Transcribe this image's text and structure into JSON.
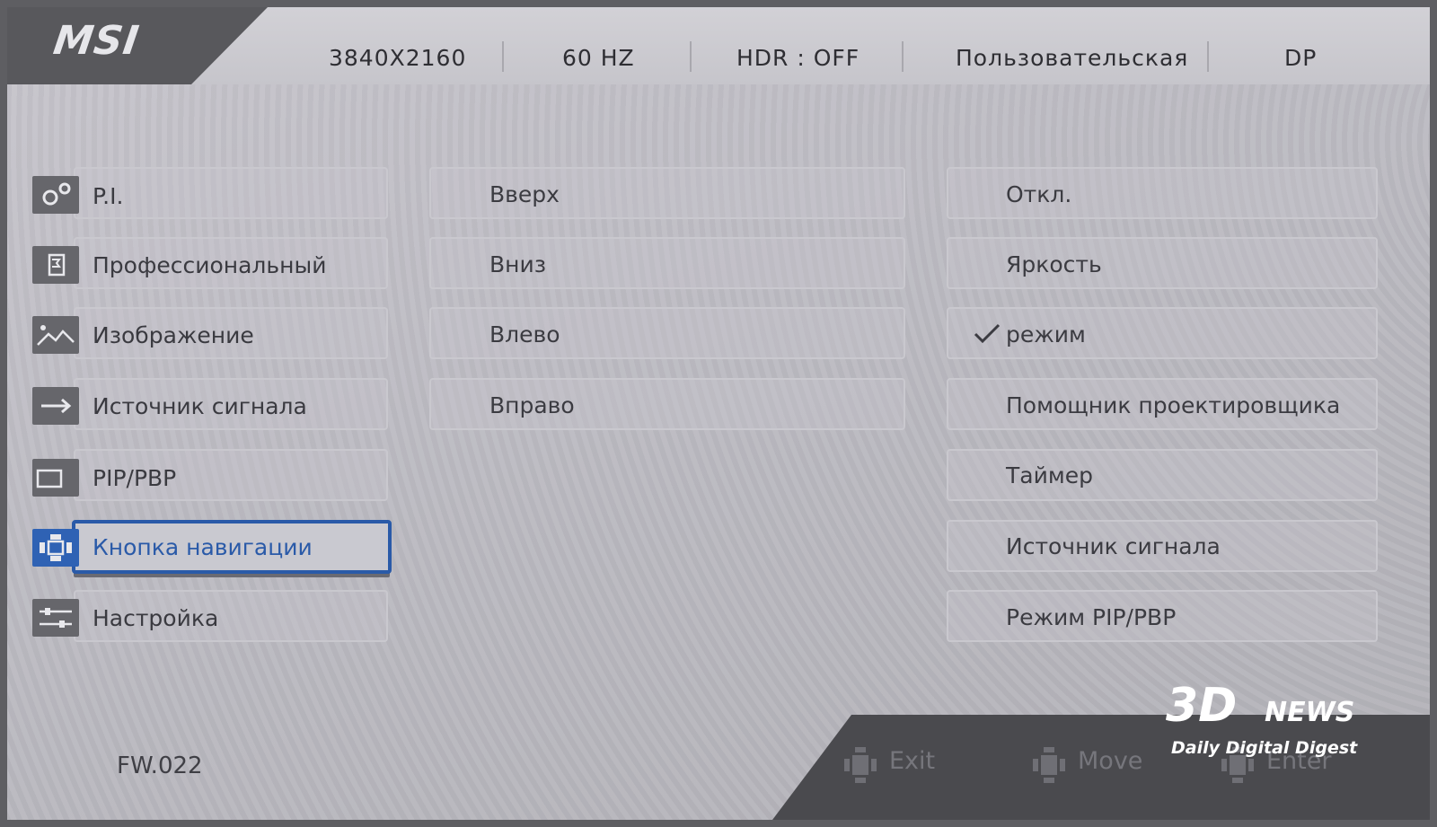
{
  "brand": {
    "logo_text": "MSI"
  },
  "status_bar": {
    "resolution": "3840X2160",
    "refresh": "60 HZ",
    "hdr": "HDR : OFF",
    "mode": "Пользовательская",
    "input": "DP"
  },
  "sidebar": {
    "items": [
      {
        "label": "P.I.",
        "icon": "gears-icon"
      },
      {
        "label": "Профессиональный",
        "icon": "flag-icon"
      },
      {
        "label": "Изображение",
        "icon": "image-icon"
      },
      {
        "label": "Источник сигнала",
        "icon": "input-arrow-icon"
      },
      {
        "label": "PIP/PBP",
        "icon": "pip-icon"
      },
      {
        "label": "Кнопка навигации",
        "icon": "nav-button-icon",
        "selected": true
      },
      {
        "label": "Настройка",
        "icon": "sliders-icon"
      }
    ]
  },
  "directions": {
    "items": [
      "Вверх",
      "Вниз",
      "Влево",
      "Вправо"
    ]
  },
  "options": {
    "items": [
      {
        "label": "Откл."
      },
      {
        "label": "Яркость"
      },
      {
        "label": "режим",
        "checked": true
      },
      {
        "label": "Помощник проектировщика"
      },
      {
        "label": "Таймер"
      },
      {
        "label": "Источник сигнала"
      },
      {
        "label": "Режим PIP/PBP"
      }
    ]
  },
  "footer": {
    "firmware": "FW.022",
    "exit": "Exit",
    "move": "Move",
    "enter": "Enter"
  },
  "watermark": {
    "big": "3D",
    "news": "NEWS",
    "sub": "Daily Digital Digest"
  },
  "colors": {
    "accent": "#2a5aa8",
    "icon_bg": "#66666b",
    "panel_dark": "#4a4a4e"
  }
}
